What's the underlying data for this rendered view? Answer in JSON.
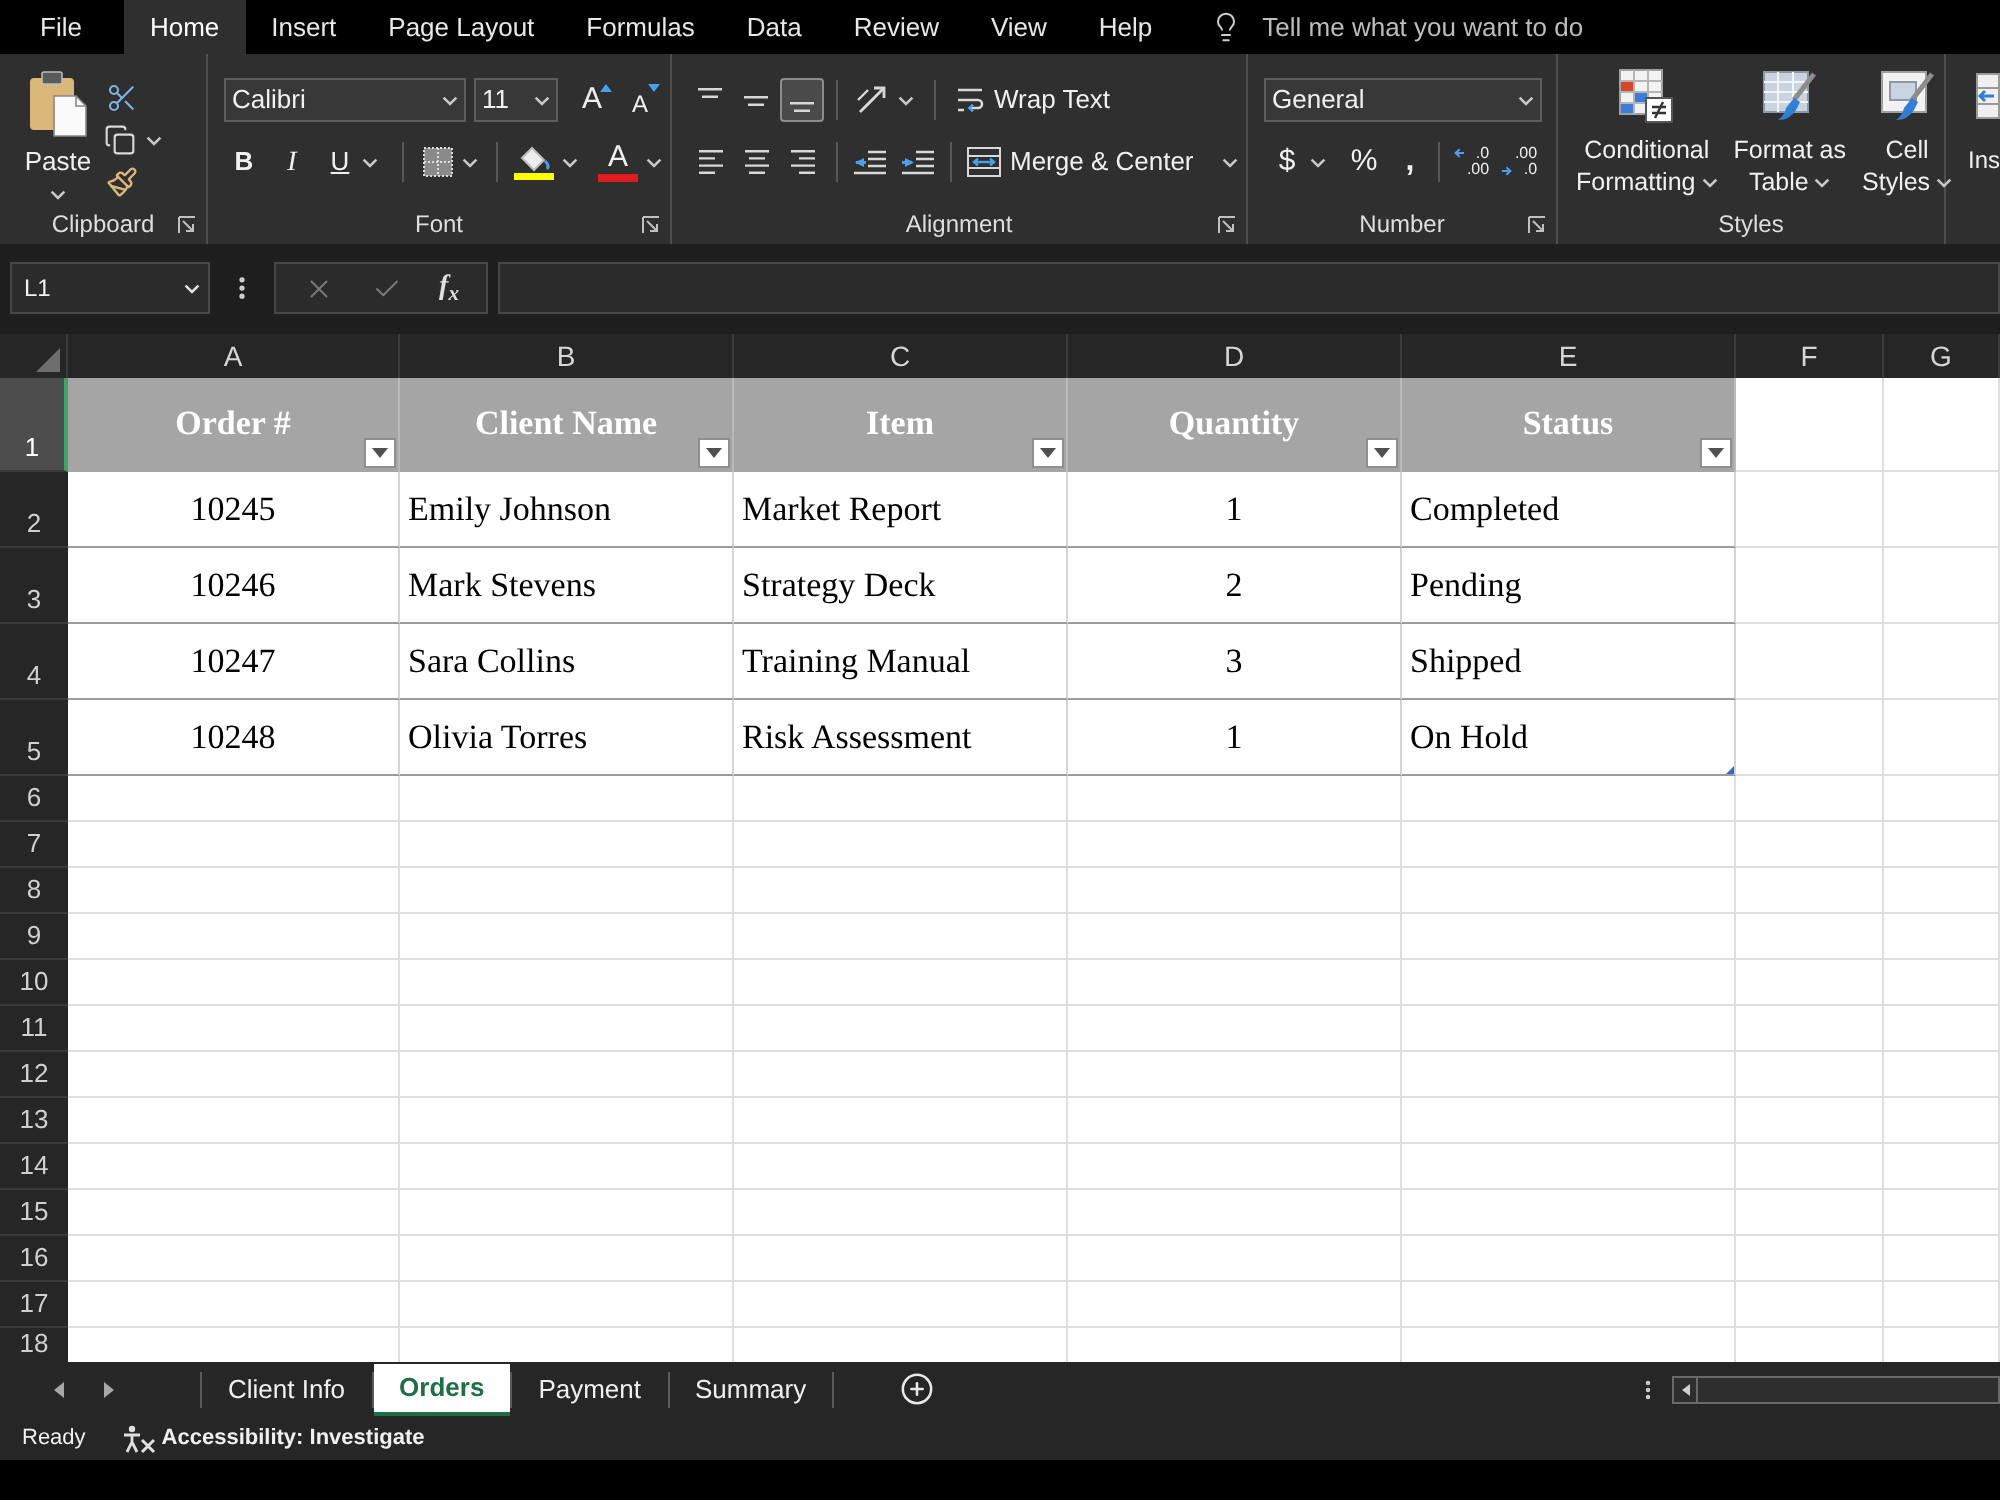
{
  "menu_tabs": [
    {
      "label": "File",
      "selected": false
    },
    {
      "label": "Home",
      "selected": true
    },
    {
      "label": "Insert",
      "selected": false
    },
    {
      "label": "Page Layout",
      "selected": false
    },
    {
      "label": "Formulas",
      "selected": false
    },
    {
      "label": "Data",
      "selected": false
    },
    {
      "label": "Review",
      "selected": false
    },
    {
      "label": "View",
      "selected": false
    },
    {
      "label": "Help",
      "selected": false
    }
  ],
  "tell_me": {
    "placeholder": "Tell me what you want to do"
  },
  "ribbon": {
    "clipboard": {
      "paste": "Paste",
      "label": "Clipboard"
    },
    "font": {
      "font_name": "Calibri",
      "font_size": "11",
      "grow_font": "A",
      "shrink_font": "A",
      "bold": "B",
      "italic": "I",
      "underline": "U",
      "font_color": "A",
      "label": "Font"
    },
    "alignment": {
      "vertical": [
        {
          "kind": "top",
          "selected": false
        },
        {
          "kind": "middle",
          "selected": false
        },
        {
          "kind": "bottom",
          "selected": true
        }
      ],
      "horizontal": [
        {
          "kind": "left",
          "selected": false
        },
        {
          "kind": "center",
          "selected": false
        },
        {
          "kind": "right",
          "selected": false
        }
      ],
      "wrap_text": "Wrap Text",
      "merge_center": "Merge & Center",
      "label": "Alignment"
    },
    "number": {
      "format": "General",
      "currency": "$",
      "percent": "%",
      "comma": ",",
      "increase_decimal": {
        "top": ".0",
        "bottom": ".00"
      },
      "decrease_decimal": {
        "top": ".00",
        "bottom": ".0"
      },
      "label": "Number"
    },
    "styles": {
      "buttons": [
        {
          "kind": "conditional_formatting",
          "lines": [
            "Conditional",
            "Formatting"
          ]
        },
        {
          "kind": "format_as_table",
          "lines": [
            "Format as",
            "Table"
          ]
        },
        {
          "kind": "cell_styles",
          "lines": [
            "Cell",
            "Styles"
          ]
        }
      ],
      "label": "Styles"
    },
    "cells": {
      "insert": "Ins"
    }
  },
  "formula_bar": {
    "name_box": "L1",
    "function_button": "f$_{x}$"
  },
  "sheet": {
    "columns": [
      "A",
      "B",
      "C",
      "D",
      "E",
      "F",
      "G"
    ],
    "row_headers": [
      {
        "label": "1",
        "selected": true
      },
      {
        "label": "2",
        "selected": false
      },
      {
        "label": "3",
        "selected": false
      },
      {
        "label": "4",
        "selected": false
      },
      {
        "label": "5",
        "selected": false
      },
      {
        "label": "6",
        "selected": false
      },
      {
        "label": "7",
        "selected": false
      },
      {
        "label": "8",
        "selected": false
      },
      {
        "label": "9",
        "selected": false
      },
      {
        "label": "10",
        "selected": false
      },
      {
        "label": "11",
        "selected": false
      },
      {
        "label": "12",
        "selected": false
      },
      {
        "label": "13",
        "selected": false
      },
      {
        "label": "14",
        "selected": false
      },
      {
        "label": "15",
        "selected": false
      },
      {
        "label": "16",
        "selected": false
      },
      {
        "label": "17",
        "selected": false
      },
      {
        "label": "18",
        "selected": false
      }
    ],
    "table": {
      "columns": [
        {
          "label": "Order #",
          "kind": "number"
        },
        {
          "label": "Client Name",
          "kind": "text"
        },
        {
          "label": "Item",
          "kind": "text"
        },
        {
          "label": "Quantity",
          "kind": "number"
        },
        {
          "label": "Status",
          "kind": "text"
        }
      ],
      "rows": [
        [
          "10245",
          "Emily Johnson",
          "Market Report",
          "1",
          "Completed"
        ],
        [
          "10246",
          "Mark Stevens",
          "Strategy Deck",
          "2",
          "Pending"
        ],
        [
          "10247",
          "Sara Collins",
          "Training Manual",
          "3",
          "Shipped"
        ],
        [
          "10248",
          "Olivia Torres",
          "Risk Assessment",
          "1",
          "On Hold"
        ]
      ]
    }
  },
  "sheet_tabs": [
    {
      "label": "Client Info",
      "selected": false
    },
    {
      "label": "Orders",
      "selected": true
    },
    {
      "label": "Payment",
      "selected": false
    },
    {
      "label": "Summary",
      "selected": false
    }
  ],
  "status_bar": {
    "status": "Ready",
    "accessibility": "Accessibility: Investigate"
  }
}
